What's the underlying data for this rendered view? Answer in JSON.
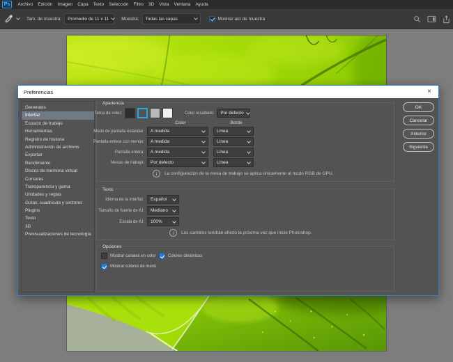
{
  "app": {
    "logo_text": "Ps"
  },
  "menu": {
    "items": [
      "Archivo",
      "Edición",
      "Imagen",
      "Capa",
      "Texto",
      "Selección",
      "Filtro",
      "3D",
      "Vista",
      "Ventana",
      "Ayuda"
    ]
  },
  "options_bar": {
    "sample_size_label": "Tam. de muestra:",
    "sample_size_value": "Promedio de 11 x 11",
    "sample_label": "Muestra:",
    "sample_value": "Todas las capas",
    "show_ring": {
      "label": "Mostrar aro de muestra",
      "checked": true
    }
  },
  "icons": {
    "eyedropper": "eyedropper-tool",
    "search": "magnifier",
    "workspace": "workspace-switcher",
    "share": "share-arrow",
    "info": "i",
    "chevron_down": "v"
  },
  "dialog": {
    "title": "Preferencias",
    "close_glyph": "×",
    "sidebar": {
      "selected": "Interfaz",
      "items": [
        "Generales",
        "Interfaz",
        "Espacio de trabajo",
        "Herramientas",
        "Registro de historia",
        "Administración de archivos",
        "Exportar",
        "Rendimiento",
        "Discos de memoria virtual",
        "Cursores",
        "Transparencia y gama",
        "Unidades y reglas",
        "Guías, cuadrícula y sectores",
        "Plugins",
        "Texto",
        "3D",
        "Previsualizaciones de tecnología"
      ]
    },
    "appearance": {
      "title": "Apariencia",
      "theme_label": "Tema de color:",
      "swatches": [
        "#2d2d2d",
        "#535353",
        "#b8b8b8",
        "#f0f0f0"
      ],
      "selected_swatch_index": 1,
      "highlight_label": "Color resaltado:",
      "highlight_value": "Por defecto",
      "column_color": "Color",
      "column_border": "Borde",
      "rows": [
        {
          "label": "Modo de pantalla estándar:",
          "color": "A medida",
          "border": "Línea"
        },
        {
          "label": "Pantalla entera con menús:",
          "color": "A medida",
          "border": "Línea"
        },
        {
          "label": "Pantalla entera:",
          "color": "A medida",
          "border": "Línea"
        },
        {
          "label": "Mesas de trabajo:",
          "color": "Por defecto",
          "border": "Línea"
        }
      ],
      "info": "La configuración de la mesa de trabajo se aplica únicamente al modo RGB de GPU."
    },
    "text_section": {
      "title": "Texto",
      "rows": [
        {
          "label": "Idioma de la interfaz:",
          "value": "Español"
        },
        {
          "label": "Tamaño de fuente de IU:",
          "value": "Mediano"
        },
        {
          "label": "Escala de IU:",
          "value": "100%"
        }
      ],
      "info": "Los cambios tendrán efecto la próxima vez que inicie Photoshop."
    },
    "options_section": {
      "title": "Opciones",
      "checkboxes": [
        {
          "label": "Mostrar canales en color",
          "checked": false
        },
        {
          "label": "Colores dinámicos",
          "checked": true
        },
        {
          "label": "Mostrar colores de menú",
          "checked": true
        }
      ]
    },
    "buttons": [
      "OK",
      "Cancelar",
      "Anterior",
      "Siguiente"
    ]
  },
  "colors": {
    "accent_blue": "#28a8e8",
    "dialog_border": "#2a7fd4",
    "checkbox_checked": "#2b7cd0",
    "canvas_gray": "#7d7d7d",
    "dialog_bg": "#535353",
    "menubar_bg": "#2b2b2b",
    "optionsbar_bg": "#3a3a3a"
  }
}
